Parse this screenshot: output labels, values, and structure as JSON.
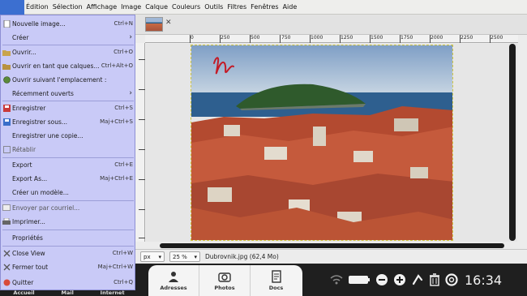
{
  "menubar": {
    "items": [
      "Édition",
      "Sélection",
      "Affichage",
      "Image",
      "Calque",
      "Couleurs",
      "Outils",
      "Filtres",
      "Fenêtres",
      "Aide"
    ]
  },
  "menu": {
    "items": [
      {
        "label": "Nouvelle image...",
        "shortcut": "Ctrl+N"
      },
      {
        "label": "Créer",
        "shortcut": ""
      },
      {
        "label": "Ouvrir...",
        "shortcut": "Ctrl+O"
      },
      {
        "label": "Ouvrir en tant que calques...",
        "shortcut": "Ctrl+Alt+O"
      },
      {
        "label": "Ouvrir suivant l'emplacement :",
        "shortcut": ""
      },
      {
        "label": "Récemment ouverts",
        "shortcut": ""
      },
      {
        "label": "Enregistrer",
        "shortcut": "Ctrl+S"
      },
      {
        "label": "Enregistrer sous...",
        "shortcut": "Maj+Ctrl+S"
      },
      {
        "label": "Enregistrer une copie...",
        "shortcut": ""
      },
      {
        "label": "Rétablir",
        "shortcut": ""
      },
      {
        "label": "Export",
        "shortcut": "Ctrl+E"
      },
      {
        "label": "Export As...",
        "shortcut": "Maj+Ctrl+E"
      },
      {
        "label": "Créer un modèle...",
        "shortcut": ""
      },
      {
        "label": "Envoyer par courriel...",
        "shortcut": ""
      },
      {
        "label": "Imprimer...",
        "shortcut": ""
      },
      {
        "label": "Propriétés",
        "shortcut": ""
      },
      {
        "label": "Close View",
        "shortcut": "Ctrl+W"
      },
      {
        "label": "Fermer tout",
        "shortcut": "Maj+Ctrl+W"
      },
      {
        "label": "Quitter",
        "shortcut": "Ctrl+Q"
      }
    ]
  },
  "ruler": {
    "labels": [
      "0",
      "250",
      "500",
      "750",
      "1000",
      "1250",
      "1500",
      "1750",
      "2000",
      "2250",
      "2500"
    ]
  },
  "statusbar": {
    "unit": "px",
    "zoom": "25 %",
    "file": "Dubrovnik.jpg (62,4 Mo)"
  },
  "dock": {
    "items": [
      {
        "label": "Adresses",
        "icon": "contacts-icon"
      },
      {
        "label": "Photos",
        "icon": "camera-icon"
      },
      {
        "label": "Docs",
        "icon": "documents-icon"
      }
    ],
    "left_labels": [
      "Accueil",
      "Mail",
      "Internet"
    ]
  },
  "tray": {
    "clock": "16:34",
    "icons": [
      "wifi-icon",
      "battery-icon",
      "volume-down-icon",
      "volume-up-icon",
      "eject-icon",
      "trash-icon",
      "help-icon"
    ]
  },
  "colors": {
    "menu_bg": "#c9caf7",
    "selected_menu": "#3c6fd0",
    "taskbar": "#1f1f1f"
  }
}
